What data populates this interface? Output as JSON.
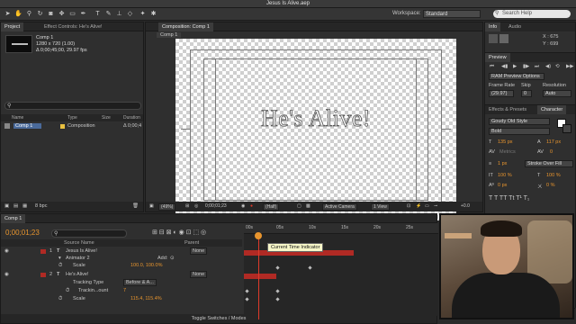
{
  "window": {
    "title": "Jesus Is Alive.aep"
  },
  "toolbar": {
    "workspace_label": "Workspace:",
    "workspace_value": "Standard",
    "search_placeholder": "Search Help"
  },
  "project": {
    "tab_project": "Project",
    "tab_effects": "Effect Controls: He's Alive!",
    "item_name": "Comp 1",
    "item_info1": "1280 x 720 (1.00)",
    "item_info2": "Δ 0;00;45;00, 29.97 fps",
    "col_name": "Name",
    "col_type": "Type",
    "col_size": "Size",
    "col_duration": "Duration",
    "row_name": "Comp 1",
    "row_type": "Composition",
    "row_duration": "Δ 0;00;4",
    "bpc": "8 bpc"
  },
  "composition": {
    "tab": "Composition: Comp 1",
    "subtab": "Comp 1",
    "headline": "He's Alive!",
    "zoom": "(49%)",
    "timecode": "0;00;01;23",
    "resolution": "(Half)",
    "camera": "Active Camera",
    "view": "1 View",
    "offset": "+0.0"
  },
  "info": {
    "tab_info": "Info",
    "tab_audio": "Audio",
    "x": "X : 675",
    "y": "Y : 699"
  },
  "preview": {
    "tab": "Preview",
    "ram": "RAM Preview Options",
    "frame_rate_label": "Frame Rate",
    "skip_label": "Skip",
    "resolution_label": "Resolution",
    "frame_rate": "(29.97)",
    "skip": "0",
    "resolution": "Auto"
  },
  "character": {
    "tab_effects": "Effects & Presets",
    "tab_char": "Character",
    "font": "Goudy Old Style",
    "style": "Bold",
    "size": "135 px",
    "leading": "117 px",
    "kerning": "Metrics",
    "tracking": "0",
    "stroke_width": "1 px",
    "stroke_mode": "Stroke Over Fill",
    "vscale": "100 %",
    "hscale": "100 %",
    "baseline": "0 px",
    "tsume": "0 %"
  },
  "timeline": {
    "tab": "Comp 1",
    "time": "0;00;01;23",
    "col_source": "Source Name",
    "col_parent": "Parent",
    "layer1_num": "1",
    "layer1_name": "Jesus Is Alive!",
    "layer1_parent": "None",
    "animator": "Animator 2",
    "add_label": "Add:",
    "scale_label": "Scale",
    "scale1_value": "100.0, 100.0%",
    "layer2_num": "2",
    "layer2_name": "He's Alive!",
    "layer2_parent": "None",
    "tracking_type_label": "Tracking Type",
    "tracking_type_value": "Before & A...",
    "tracking_amount_label": "Trackin...ount",
    "tracking_amount_value": "7",
    "scale2_value": "115.4, 115.4%",
    "ticks": [
      "00s",
      "05s",
      "10s",
      "15s",
      "20s",
      "25s"
    ],
    "tooltip": "Current Time Indicator",
    "footer": "Toggle Switches / Modes"
  },
  "colors": {
    "accent": "#e8952e",
    "cti": "#e03a2a",
    "layer_bar": "#b02a24"
  }
}
